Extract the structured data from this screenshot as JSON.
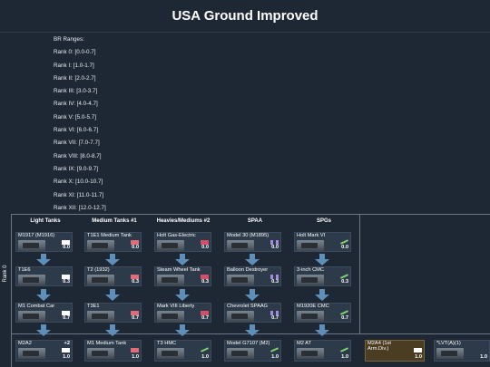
{
  "title": "USA Ground Improved",
  "br_ranges": {
    "heading": "BR Ranges:",
    "lines": [
      "Rank 0: [0.0-0.7]",
      "Rank I: [1.0-1.7]",
      "Rank II: [2.0-2.7]",
      "Rank III: [3.0-3.7]",
      "Rank IV: [4.0-4.7]",
      "Rank V: [5.0-5.7]",
      "Rank VI: [6.0-6.7]",
      "Rank VII: [7.0-7.7]",
      "Rank VIII: [8.0-8.7]",
      "Rank IX: [9.0-9.7]",
      "Rank X: [10.0-10.7]",
      "Rank XI: [11.0-11.7]",
      "Rank XII: [12.0-12.7]"
    ]
  },
  "columns": [
    "Light Tanks",
    "Medium Tanks #1",
    "Heavies/Mediums #2",
    "SPAA",
    "SPGs"
  ],
  "ranks": [
    "Rank 0"
  ],
  "rank0": [
    [
      {
        "name": "M1917 (M1916)",
        "rating": "0.0",
        "icon": "light-tank-icon"
      },
      {
        "name": "T1E6",
        "rating": "0.3",
        "icon": "light-tank-icon"
      },
      {
        "name": "M1 Combat Car",
        "rating": "0.7",
        "icon": "light-tank-icon"
      }
    ],
    [
      {
        "name": "T1E1 Medium Tank",
        "rating": "0.0",
        "icon": "medium-tank-icon"
      },
      {
        "name": "T2 (1932)",
        "rating": "0.3",
        "icon": "medium-tank-icon"
      },
      {
        "name": "T3E1",
        "rating": "0.7",
        "icon": "medium-tank-icon"
      }
    ],
    [
      {
        "name": "Holt Gas-Electric",
        "rating": "0.0",
        "icon": "heavy-tank-icon"
      },
      {
        "name": "Steam Wheel Tank",
        "rating": "0.3",
        "icon": "heavy-tank-icon"
      },
      {
        "name": "Mark VIII Liberty",
        "rating": "0.7",
        "icon": "heavy-tank-icon"
      }
    ],
    [
      {
        "name": "Model 30 (M1895)",
        "rating": "0.0",
        "icon": "spaa-icon"
      },
      {
        "name": "Balloon Destroyer",
        "rating": "0.3",
        "icon": "spaa-icon"
      },
      {
        "name": "Chevrolet SPAAG",
        "rating": "0.7",
        "icon": "spaa-icon"
      }
    ],
    [
      {
        "name": "Holt Mark VI",
        "rating": "0.0",
        "icon": "spg-icon"
      },
      {
        "name": "3-inch CMC",
        "rating": "0.3",
        "icon": "spg-icon"
      },
      {
        "name": "M1920E CMC",
        "rating": "0.7",
        "icon": "spg-icon"
      }
    ]
  ],
  "rank1_row": [
    {
      "name": "M2A2",
      "rating": "1.0",
      "badge": "+2",
      "icon": "light-tank-icon"
    },
    {
      "name": "M1 Medium Tank",
      "rating": "1.0",
      "icon": "medium-tank-icon"
    },
    {
      "name": "T3 HMC",
      "rating": "1.0",
      "icon": "spg-icon"
    },
    {
      "name": "Model G7107 (M2)",
      "rating": "1.0",
      "icon": "spg-icon"
    },
    {
      "name": "M2 AT",
      "rating": "1.0",
      "icon": "spg-icon"
    },
    {
      "name": "M2A4 (1st Arm.Div.)",
      "rating": "1.0",
      "icon": "light-tank-icon",
      "premium": true
    },
    {
      "name": "*LVT(A)(1)",
      "rating": "1.0",
      "icon": "light-tank-icon"
    }
  ]
}
